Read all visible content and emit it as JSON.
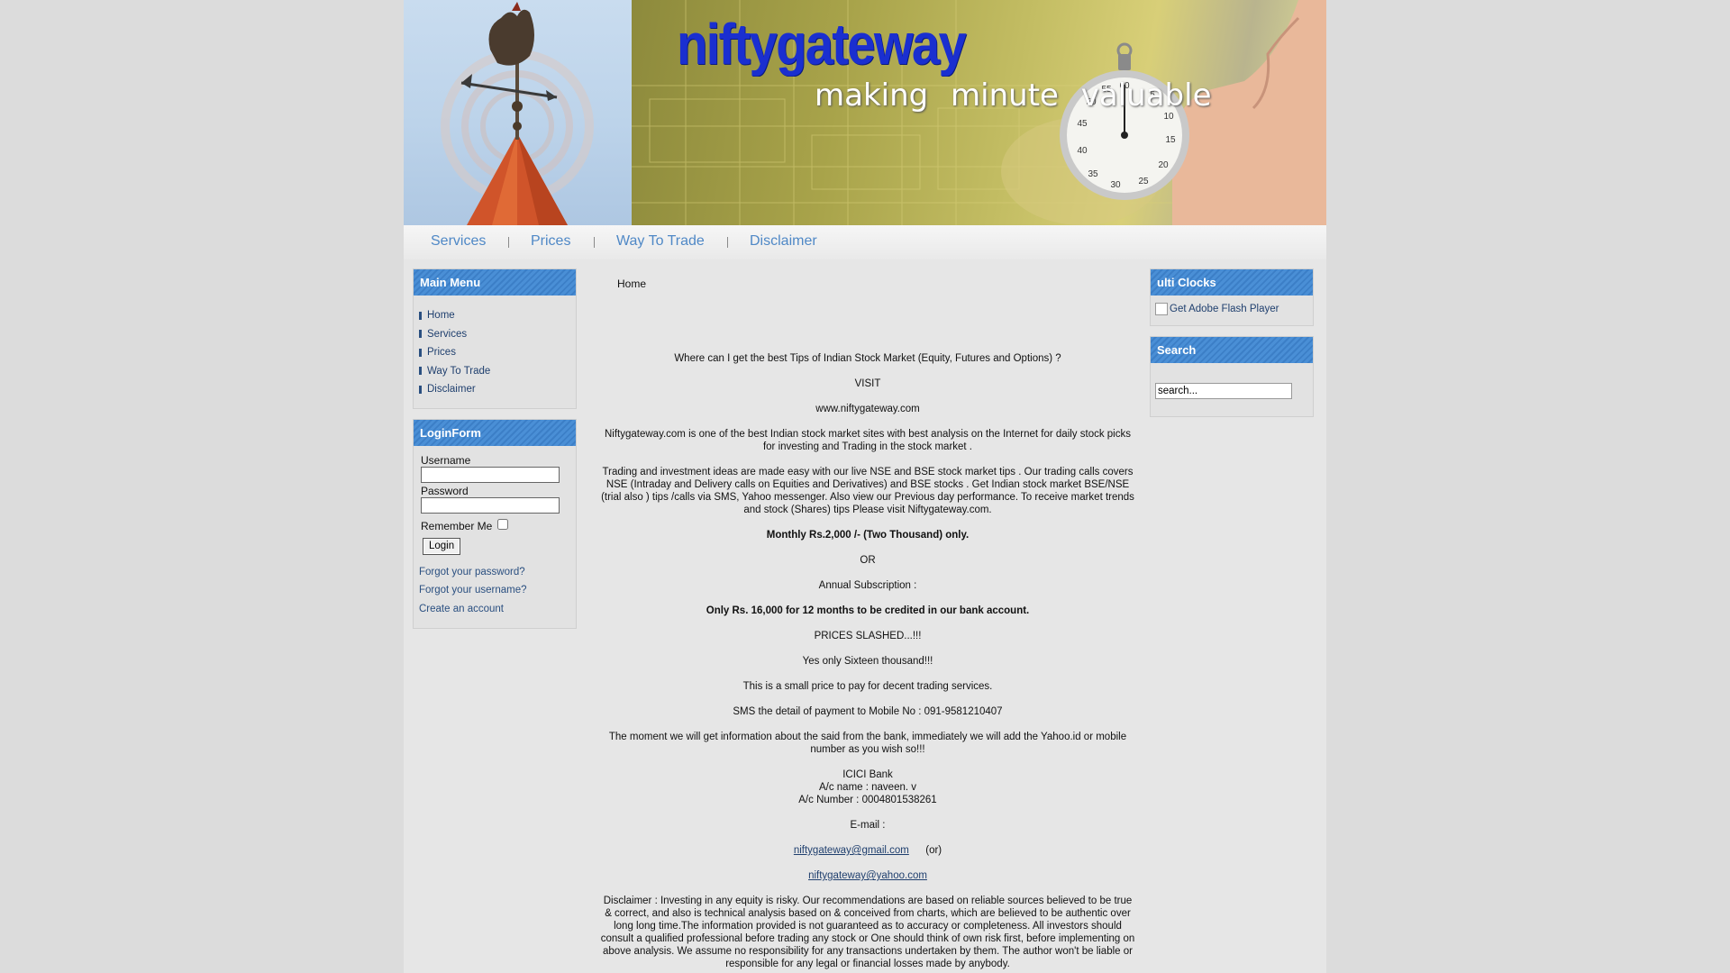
{
  "header": {
    "site_name": "niftygateway",
    "tagline": "making minute valuable"
  },
  "topnav": {
    "items": [
      {
        "label": "Services"
      },
      {
        "label": "Prices"
      },
      {
        "label": "Way To Trade"
      },
      {
        "label": "Disclaimer"
      }
    ]
  },
  "main_menu": {
    "title": "Main Menu",
    "items": [
      {
        "label": "Home"
      },
      {
        "label": "Services"
      },
      {
        "label": "Prices"
      },
      {
        "label": "Way To Trade"
      },
      {
        "label": "Disclaimer"
      }
    ]
  },
  "login_form": {
    "title": "LoginForm",
    "username_label": "Username",
    "password_label": "Password",
    "username_value": "",
    "password_value": "",
    "remember_label": "Remember Me",
    "remember_checked": false,
    "login_button": "Login",
    "forgot_password": "Forgot your password?",
    "forgot_username": "Forgot your username?",
    "create_account": "Create an account"
  },
  "right": {
    "clocks_title": "ulti Clocks",
    "flash_alt": "Get Adobe Flash Player",
    "search_title": "Search",
    "search_value": "search..."
  },
  "content": {
    "breadcrumb": "Home",
    "question": "Where can I get the best Tips of Indian Stock Market (Equity, Futures and Options) ?",
    "visit": "VISIT",
    "site_url": "www.niftygateway.com",
    "intro": "Niftygateway.com is one of the best Indian stock market sites with best analysis on the Internet for daily stock picks for investing and Trading in the stock market .",
    "trading": "Trading and investment ideas are made easy with our live NSE and BSE stock market tips . Our trading calls covers NSE (Intraday and Delivery calls on Equities and Derivatives) and BSE stocks . Get Indian stock market BSE/NSE (trial also ) tips /calls via SMS, Yahoo messenger. Also view our Previous day performance. To receive market trends and stock (Shares) tips Please visit Niftygateway.com.",
    "monthly": "Monthly Rs.2,000 /- (Two Thousand) only.",
    "or": "OR",
    "annual": "Annual Subscription :",
    "annual_price": "Only Rs. 16,000 for 12 months to be credited in our bank account.",
    "slashed": "PRICES SLASHED...!!!",
    "sixteen": "Yes only Sixteen thousand!!!",
    "small_price": "This is a small price to pay for decent trading services.",
    "sms": "SMS the detail of payment to Mobile No : 091-9581210407",
    "moment": "The moment we will get information about the said from the bank, immediately we will add the Yahoo.id or mobile number as you wish so!!!",
    "bank": "ICICI Bank",
    "ac_name": "A/c name : naveen. v",
    "ac_number": "A/c Number : 0004801538261",
    "email_label": "E-mail :",
    "email1": "niftygateway@gmail.com",
    "email_or": "(or)",
    "email2": "niftygateway@yahoo.com",
    "disclaimer": "Disclaimer : Investing in any equity is risky. Our recommendations are based on reliable sources believed to be true & correct, and also is technical analysis based on & conceived from charts, which are believed to be authentic over long long time.The information provided is not guaranteed as to accuracy or completeness. All investors should consult a qualified professional before trading any stock or One should think of own risk first, before implementing on above analysis. We assume no responsibility for any transactions undertaken by them. The author won't be liable or responsible for any legal or financial losses made by anybody."
  }
}
